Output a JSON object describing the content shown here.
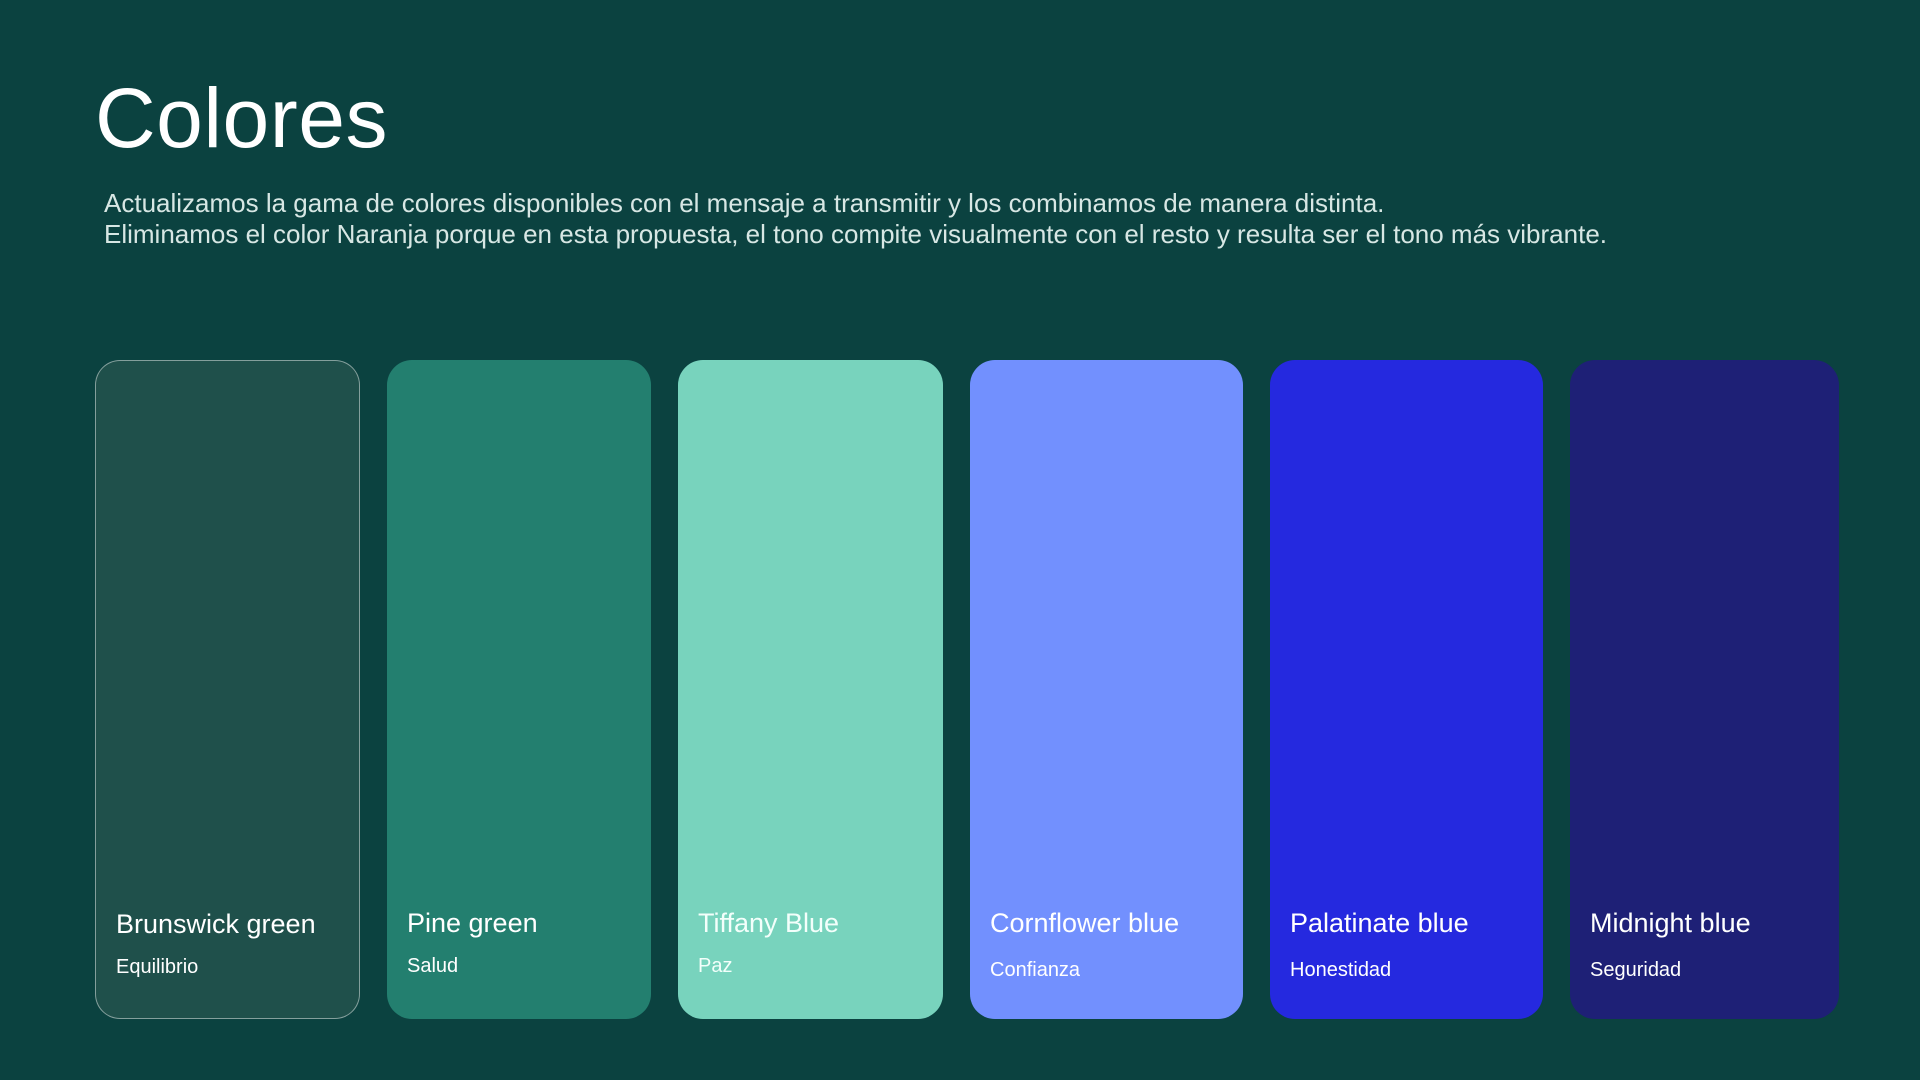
{
  "page": {
    "background": "#0b4240",
    "title": "Colores",
    "description_lines": [
      "Actualizamos la gama de colores disponibles con el mensaje a transmitir y los combinamos de manera distinta.",
      "Eliminamos el color Naranja porque en esta propuesta, el tono compite visualmente con el resto y resulta ser el tono más vibrante."
    ]
  },
  "swatches": [
    {
      "name": "Brunswick green",
      "meaning": "Equilibrio",
      "color": "#1f504b",
      "outlined": true
    },
    {
      "name": "Pine green",
      "meaning": "Salud",
      "color": "#237f6f",
      "outlined": false
    },
    {
      "name": "Tiffany Blue",
      "meaning": "Paz",
      "color": "#78d3bd",
      "outlined": false
    },
    {
      "name": "Cornflower blue",
      "meaning": "Confianza",
      "color": "#7290fe",
      "outlined": false
    },
    {
      "name": "Palatinate blue",
      "meaning": "Honestidad",
      "color": "#2529df",
      "outlined": false
    },
    {
      "name": "Midnight blue",
      "meaning": "Seguridad",
      "color": "#1e2076",
      "outlined": false
    }
  ]
}
